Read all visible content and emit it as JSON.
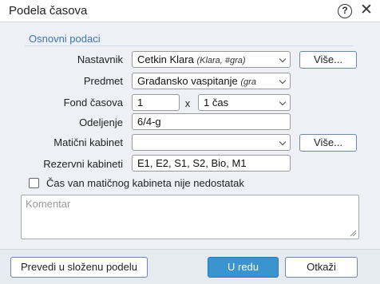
{
  "window": {
    "title": "Podela časova",
    "help_icon": "?",
    "close_icon": "✕"
  },
  "group": {
    "label": "Osnovni podaci"
  },
  "fields": {
    "nastavnik": {
      "label": "Nastavnik",
      "value": "Cetkin Klara",
      "hint": "(Klara, #gra)"
    },
    "predmet": {
      "label": "Predmet",
      "value": "Građansko vaspitanje",
      "hint": "(gra"
    },
    "fond_casova": {
      "label": "Fond časova",
      "value": "1",
      "times": "x",
      "unit": "1 čas"
    },
    "odeljenje": {
      "label": "Odeljenje",
      "value": "6/4-g"
    },
    "maticni_kabinet": {
      "label": "Matični kabinet",
      "value": ""
    },
    "rezervni_kabineti": {
      "label": "Rezervni kabineti",
      "value": "E1, E2, S1, S2, Bio, M1"
    }
  },
  "buttons": {
    "vise_nastavnik": "Više...",
    "vise_kabinet": "Više...",
    "prevedi": "Prevedi u složenu podelu",
    "ok": "U redu",
    "cancel": "Otkaži"
  },
  "checkbox": {
    "label": "Čas van matičnog kabineta nije nedostatak",
    "checked": false
  },
  "comment": {
    "placeholder": "Komentar"
  },
  "colors": {
    "accent": "#3a94cf",
    "group_label": "#3b76b8",
    "panel_bg": "#eef0f5"
  }
}
